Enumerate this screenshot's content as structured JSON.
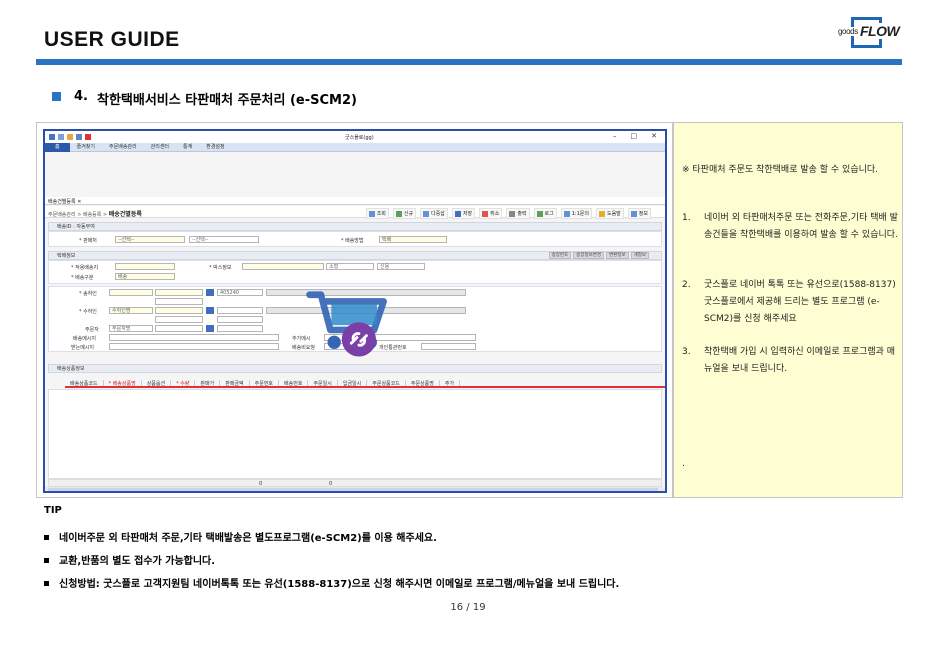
{
  "header": {
    "title": "USER GUIDE",
    "logo_small": "goods",
    "logo_big": "FLOW",
    "accent_color": "#2a74c2"
  },
  "section": {
    "number": "4.",
    "title": "착한택배서비스 타판매처 주문처리 (e-SCM2)"
  },
  "screenshot": {
    "window_title": "굿스플로(gg)",
    "controls": [
      "–",
      "□",
      "✕"
    ],
    "menu": [
      "홈",
      "즐겨찾기",
      "주문배송관리",
      "관리센터",
      "통계",
      "환경설정"
    ],
    "tab": "배송건별등록 ✕",
    "breadcrumb_path": "주문배송관리 > 배송등록 >",
    "breadcrumb_page": "배송건별등록",
    "toolbar": [
      "조회",
      "신규",
      "다중삽",
      "저장",
      "취소",
      "출력",
      "로그",
      "1:1문의",
      "도움말",
      "정보"
    ],
    "sections": {
      "id": "배송ID : 자동부여",
      "seller_label": "* 판매처",
      "seller_value": "--선택--",
      "seller_sub": "--선택--",
      "method_label": "* 배송방법",
      "method_value": "택배",
      "courier": "택배정보",
      "courier_buttons": [
        "송장번호",
        "송장정보변경",
        "변환정보",
        "개정보"
      ],
      "service_label": "* 적용배송지",
      "box_label": "* 박스정보",
      "size_value": "소형",
      "credit_value": "신용",
      "type_label": "* 배송구분",
      "type_value": "배송",
      "sender_label": "* 송하인",
      "sender_zip": "405240",
      "receiver_label": "* 수하인",
      "receiver_name": "수하인명",
      "order_label": "주문자",
      "order_name": "주문자명",
      "msg_label": "배송메시지",
      "extra_label": "추가메시",
      "receipt_label": "받는메시지",
      "ship_label": "배송비요청",
      "personal_label": "개인통관번호",
      "goods": "배송상품정보"
    },
    "grid_headers": [
      "배송상품코드",
      "* 배송상품명",
      "상품옵션",
      "* 수량",
      "판매가",
      "판매금액",
      "주문번호",
      "배송번호",
      "주문일시",
      "입금일시",
      "주문상품코드",
      "주문상품명",
      "주가"
    ],
    "grid_footer": [
      "0",
      "0"
    ]
  },
  "note": {
    "intro": "※ 타판매처 주문도 착한택배로 발송 할 수 있습니다.",
    "items": [
      {
        "num": "1.",
        "text": "네이버 외 타판매처주문 또는 전화주문,기타 택배 발송건들을 착한택배를 이용하여 발송 할 수 있습니다."
      },
      {
        "num": "2.",
        "text": "굿스플로 네이버 톡톡 또는 유선으로(1588-8137) 굿스플로에서 제공해 드리는 별도 프로그램 (e-SCM2)를 신청 해주세요"
      },
      {
        "num": "3.",
        "text": "착한택배 가입 시 입력하신 이메일로 프로그램과 매뉴얼을 보내 드립니다."
      }
    ],
    "dot": "."
  },
  "tip": {
    "label": "TIP",
    "items": [
      "네이버주문 외 타판매처 주문,기타 택배발송은 별도프로그램(e-SCM2)를 이용 해주세요.",
      "교환,반품의 별도 접수가 가능합니다.",
      "신청방법: 굿스플로 고객지원팀 네이버톡톡 또는 유선(1588-8137)으로 신청 해주시면 이메일로 프로그램/메뉴얼을 보내 드립니다."
    ]
  },
  "page": "16 / 19"
}
